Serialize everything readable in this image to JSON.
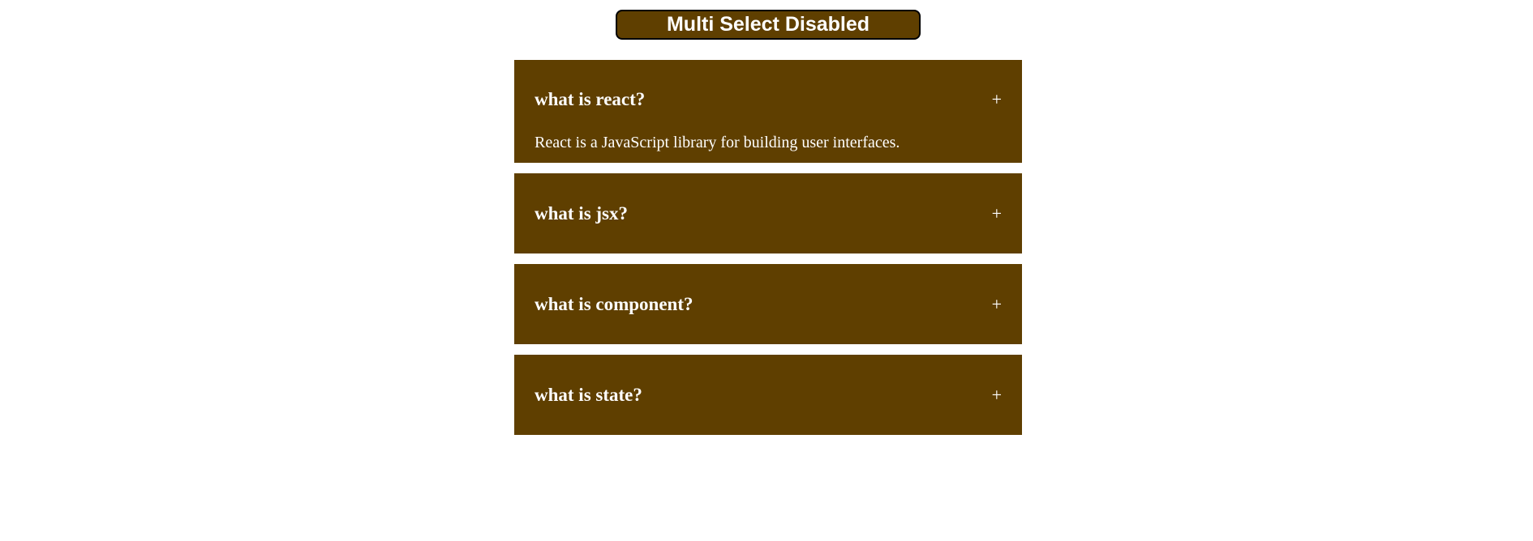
{
  "header": {
    "toggle_label": "Multi Select Disabled"
  },
  "accordion": {
    "items": [
      {
        "question": "what is react?",
        "icon": "+",
        "answer": "React is a JavaScript library for building user interfaces.",
        "open": true
      },
      {
        "question": "what is jsx?",
        "icon": "+",
        "open": false
      },
      {
        "question": "what is component?",
        "icon": "+",
        "open": false
      },
      {
        "question": "what is state?",
        "icon": "+",
        "open": false
      }
    ]
  },
  "colors": {
    "accent": "#5f3f00",
    "text": "#ffffff",
    "background": "#ffffff"
  }
}
